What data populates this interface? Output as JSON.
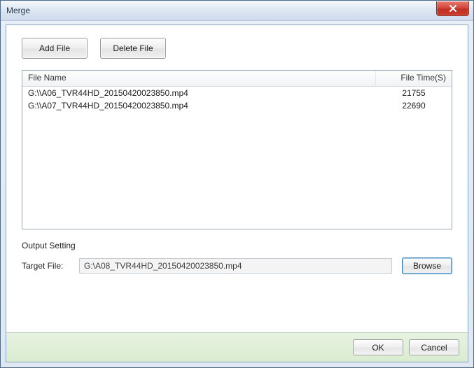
{
  "window": {
    "title": "Merge"
  },
  "toolbar": {
    "add_file_label": "Add File",
    "delete_file_label": "Delete File"
  },
  "list": {
    "header": {
      "name": "File Name",
      "time": "File Time(S)"
    },
    "rows": [
      {
        "name": "G:\\\\A06_TVR44HD_20150420023850.mp4",
        "time": "21755"
      },
      {
        "name": "G:\\\\A07_TVR44HD_20150420023850.mp4",
        "time": "22690"
      }
    ]
  },
  "output": {
    "section_label": "Output Setting",
    "target_label": "Target File:",
    "target_value": "G:\\A08_TVR44HD_20150420023850.mp4",
    "browse_label": "Browse"
  },
  "footer": {
    "ok_label": "OK",
    "cancel_label": "Cancel"
  }
}
